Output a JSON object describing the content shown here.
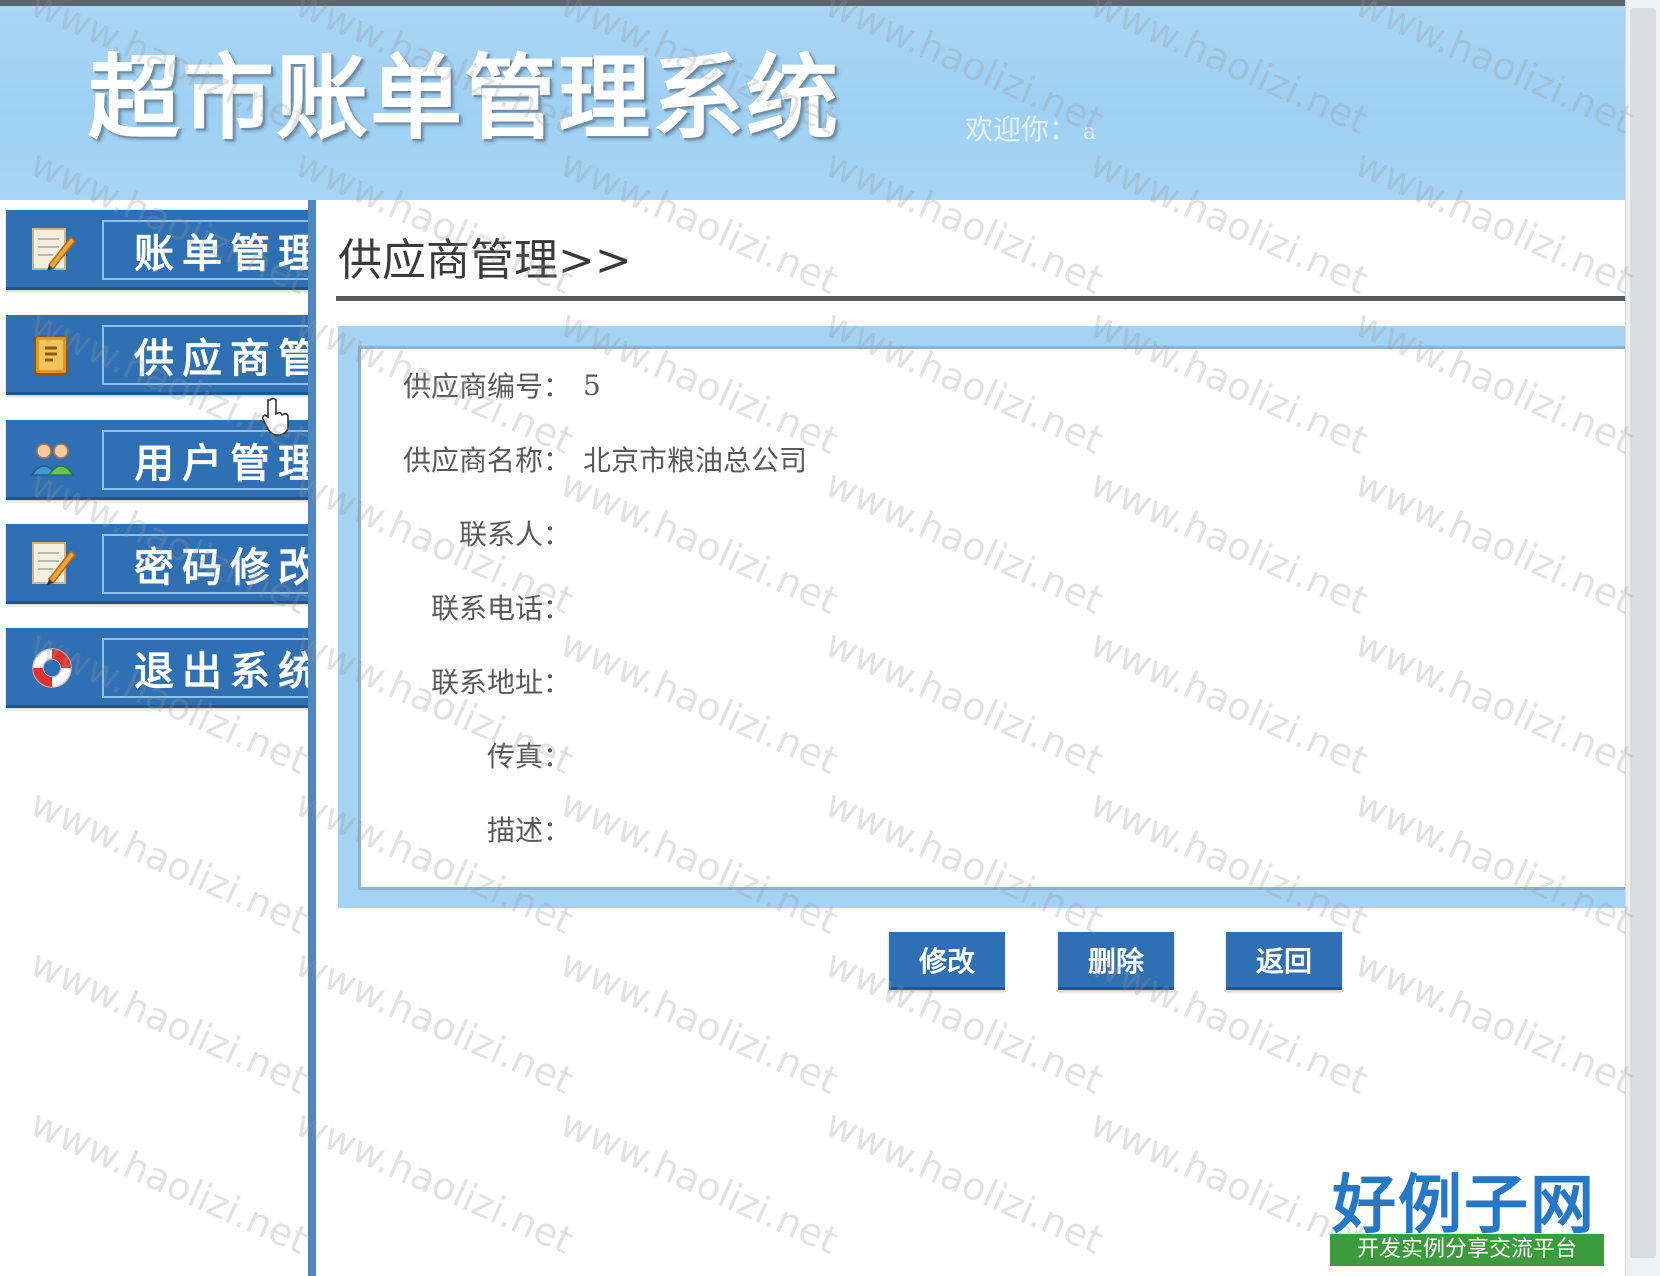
{
  "header": {
    "app_title": "超市账单管理系统",
    "welcome_label": "欢迎你：",
    "username": "a"
  },
  "sidebar": {
    "items": [
      {
        "label": "账单管理",
        "icon": "notepad-pencil-icon"
      },
      {
        "label": "供应商管理",
        "icon": "supplier-book-icon"
      },
      {
        "label": "用户管理",
        "icon": "users-icon"
      },
      {
        "label": "密码修改",
        "icon": "notepad-pencil-icon"
      },
      {
        "label": "退出系统",
        "icon": "lifebuoy-icon"
      }
    ]
  },
  "main": {
    "page_title": "供应商管理>>",
    "fields": [
      {
        "label": "供应商编号：",
        "value": "5"
      },
      {
        "label": "供应商名称：",
        "value": "北京市粮油总公司"
      },
      {
        "label": "联系人：",
        "value": ""
      },
      {
        "label": "联系电话：",
        "value": ""
      },
      {
        "label": "联系地址：",
        "value": ""
      },
      {
        "label": "传真：",
        "value": ""
      },
      {
        "label": "描述：",
        "value": ""
      }
    ],
    "buttons": {
      "modify": "修改",
      "delete": "删除",
      "back": "返回"
    }
  },
  "watermark": "www.haolizi.net",
  "brand": {
    "name": "好例子网",
    "tagline": "开发实例分享交流平台"
  },
  "colors": {
    "header_bg": "#a9d6f5",
    "nav_bg": "#2f6fb3",
    "frame_bg": "#a5d3f3",
    "brand_blue": "#2578c8",
    "brand_green": "#3c9c3c"
  }
}
